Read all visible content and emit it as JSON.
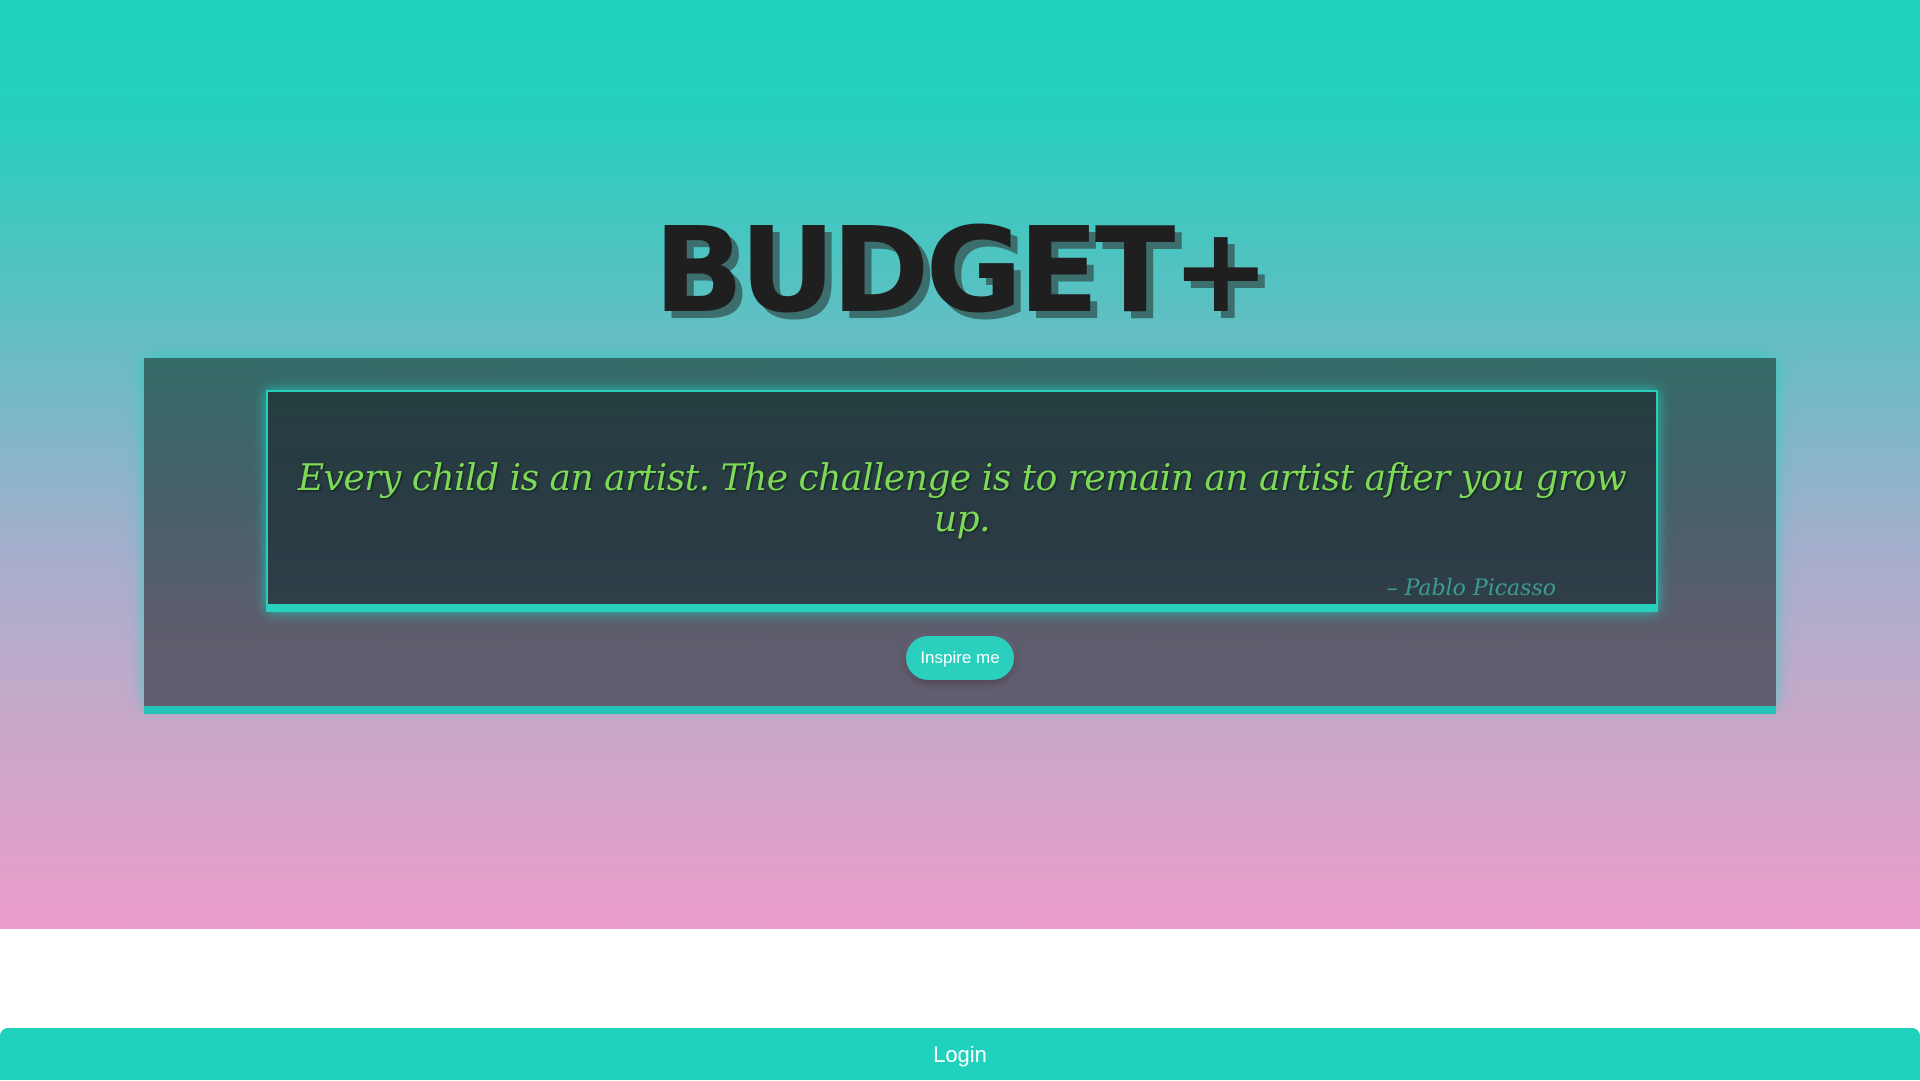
{
  "header": {
    "brand": "BUDGET+"
  },
  "quote": {
    "text": "Every child is an artist. The challenge is to remain an artist after you grow up.",
    "author": "– Pablo Picasso"
  },
  "actions": {
    "inspire_label": "Inspire me",
    "login_label": "Login"
  },
  "colors": {
    "accent": "#1ed2bd",
    "quote_text": "#7ed957",
    "gradient_top": "#1ed2bd",
    "gradient_bottom": "#eb9dcc",
    "panel": "#46606a",
    "title": "#1f1f1f"
  }
}
